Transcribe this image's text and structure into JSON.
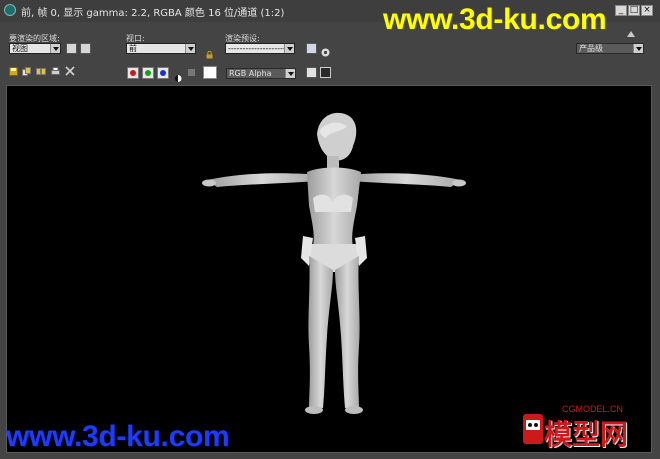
{
  "window": {
    "title": "前, 帧 0, 显示 gamma: 2.2, RGBA 颜色 16 位/通道 (1:2)",
    "minimize_glyph": "_",
    "maximize_glyph": "□",
    "close_glyph": "×"
  },
  "toolbar1": {
    "area_label": "要渲染的区域:",
    "area_value": "视图",
    "viewport_label": "视口:",
    "viewport_value": "前",
    "preset_label": "渲染预设:",
    "preset_value": "--------------------",
    "production_value": "产品级"
  },
  "toolbar2": {
    "channel_value": "RGB Alpha",
    "channels": [
      {
        "name": "red",
        "color": "#d01818"
      },
      {
        "name": "green",
        "color": "#18a018"
      },
      {
        "name": "blue",
        "color": "#1830d0"
      }
    ]
  },
  "watermarks": {
    "top": "www.3d-ku.com",
    "bottom": "www.3d-ku.com",
    "logo_small": "CGMODEL.CN",
    "logo_big": "模型网"
  },
  "colors": {
    "background": "#444444",
    "viewport": "#000000",
    "watermark_top": "#ffff00",
    "watermark_bottom": "#1c3cff",
    "logo_red": "#cc1a1a"
  }
}
